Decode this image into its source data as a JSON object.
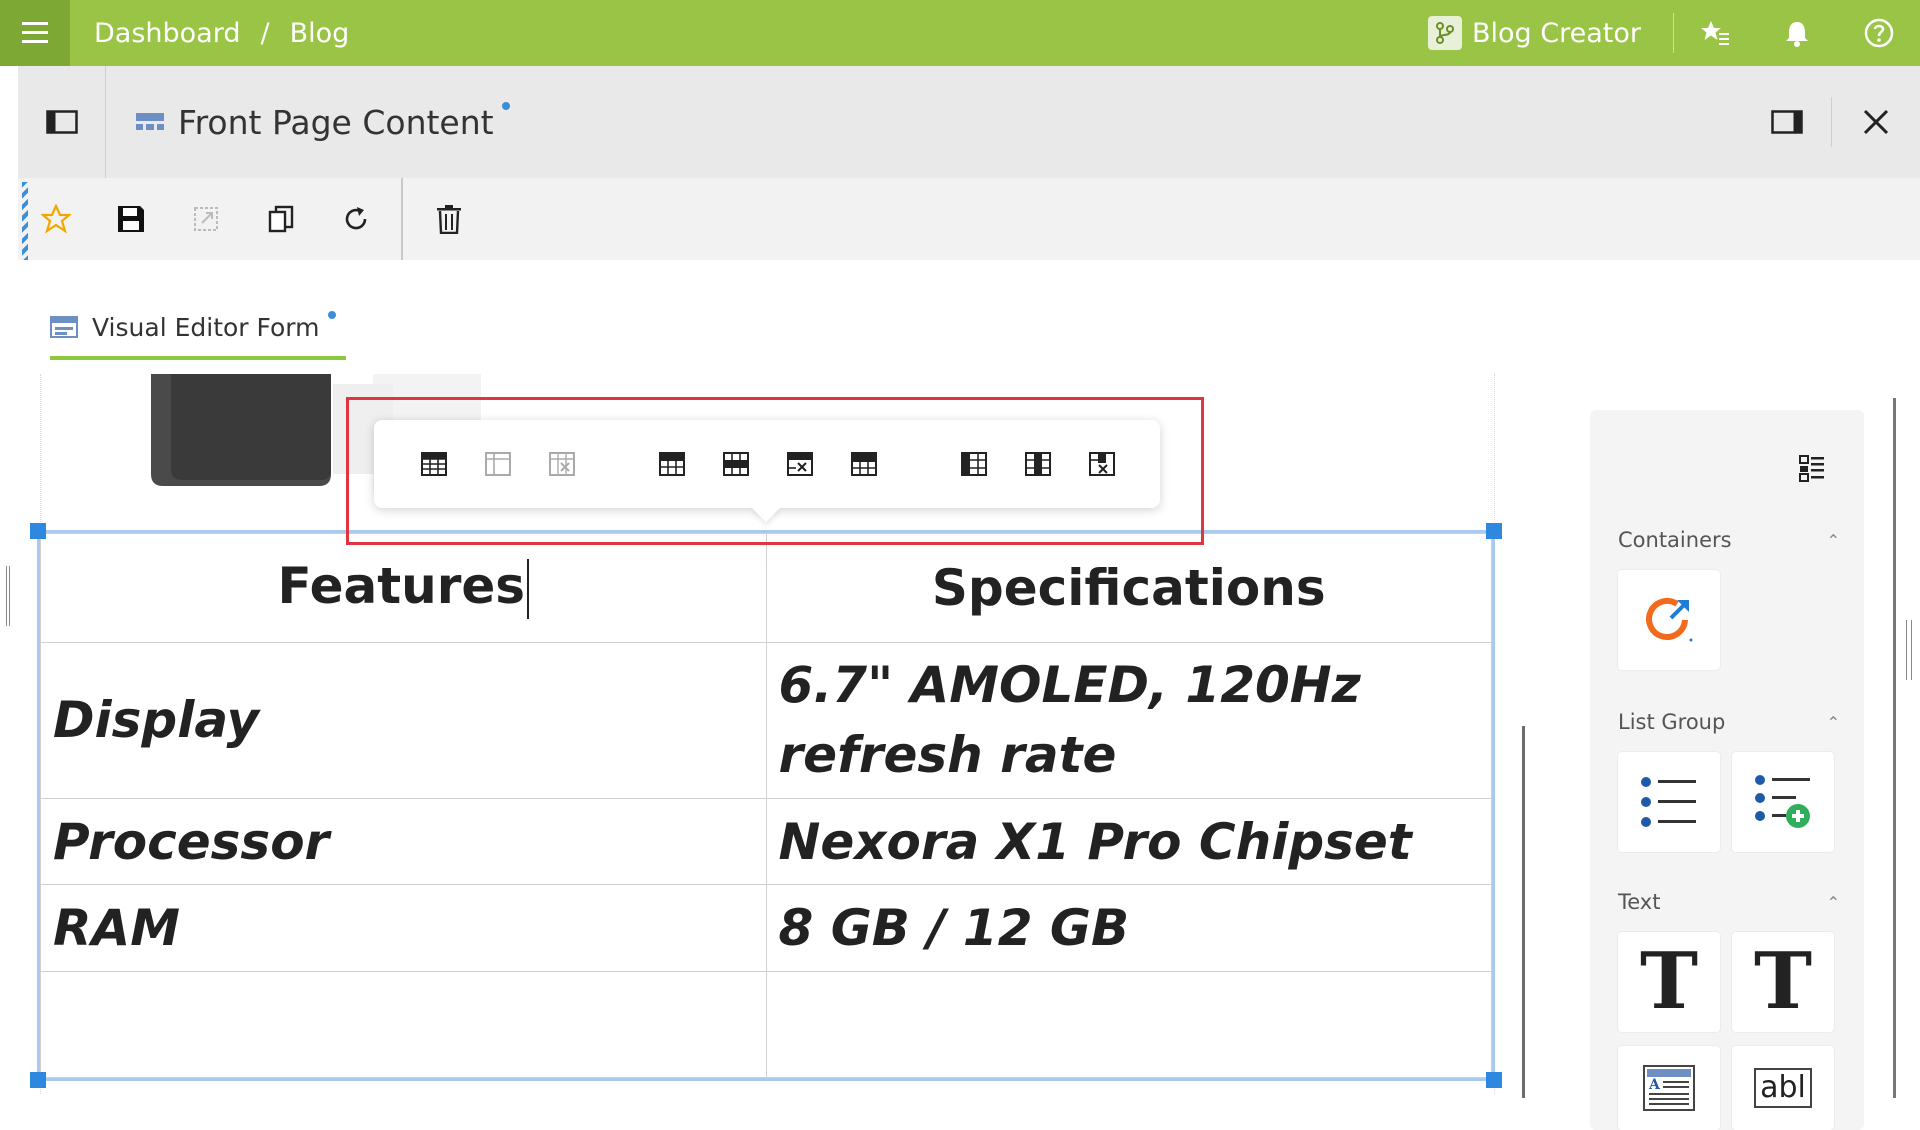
{
  "topbar": {
    "breadcrumb": [
      "Dashboard",
      "/",
      "Blog"
    ],
    "app_name": "Blog Creator"
  },
  "panel": {
    "title": "Front Page Content"
  },
  "tab": {
    "label": "Visual Editor Form"
  },
  "table": {
    "headers": [
      "Features",
      "Specifications"
    ],
    "rows": [
      [
        "Display",
        "6.7\" AMOLED, 120Hz refresh rate"
      ],
      [
        "Processor",
        "Nexora X1 Pro Chipset"
      ],
      [
        "RAM",
        "8 GB / 12 GB"
      ],
      [
        "",
        ""
      ]
    ]
  },
  "palette": {
    "sections": [
      {
        "label": "Containers"
      },
      {
        "label": "List Group"
      },
      {
        "label": "Text"
      }
    ]
  },
  "colors": {
    "topbar": "#9ac445",
    "accent": "#8dc63f",
    "selection": "#2f88e0",
    "highlight": "#e0343e"
  }
}
